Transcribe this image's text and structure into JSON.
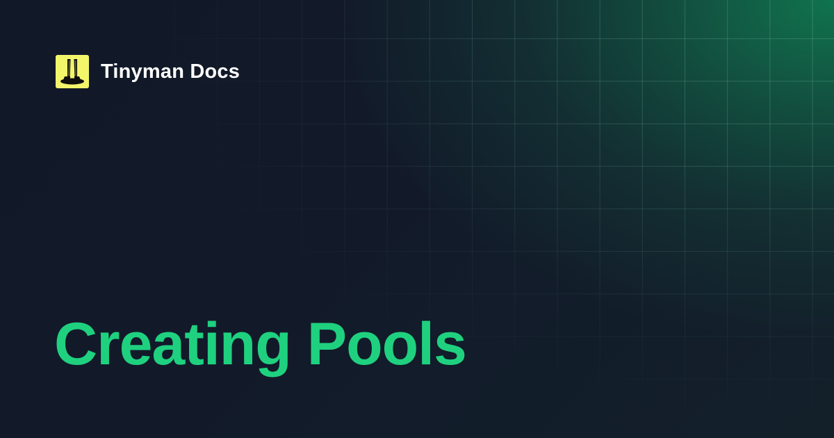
{
  "brand": {
    "name": "Tinyman Docs",
    "logo_icon": "tinyman-logo-icon"
  },
  "page": {
    "title": "Creating Pools"
  },
  "colors": {
    "title": "#1fd17f",
    "logo_bg": "#f3f56a",
    "background": "#111827",
    "accent_glow": "#10784f"
  }
}
